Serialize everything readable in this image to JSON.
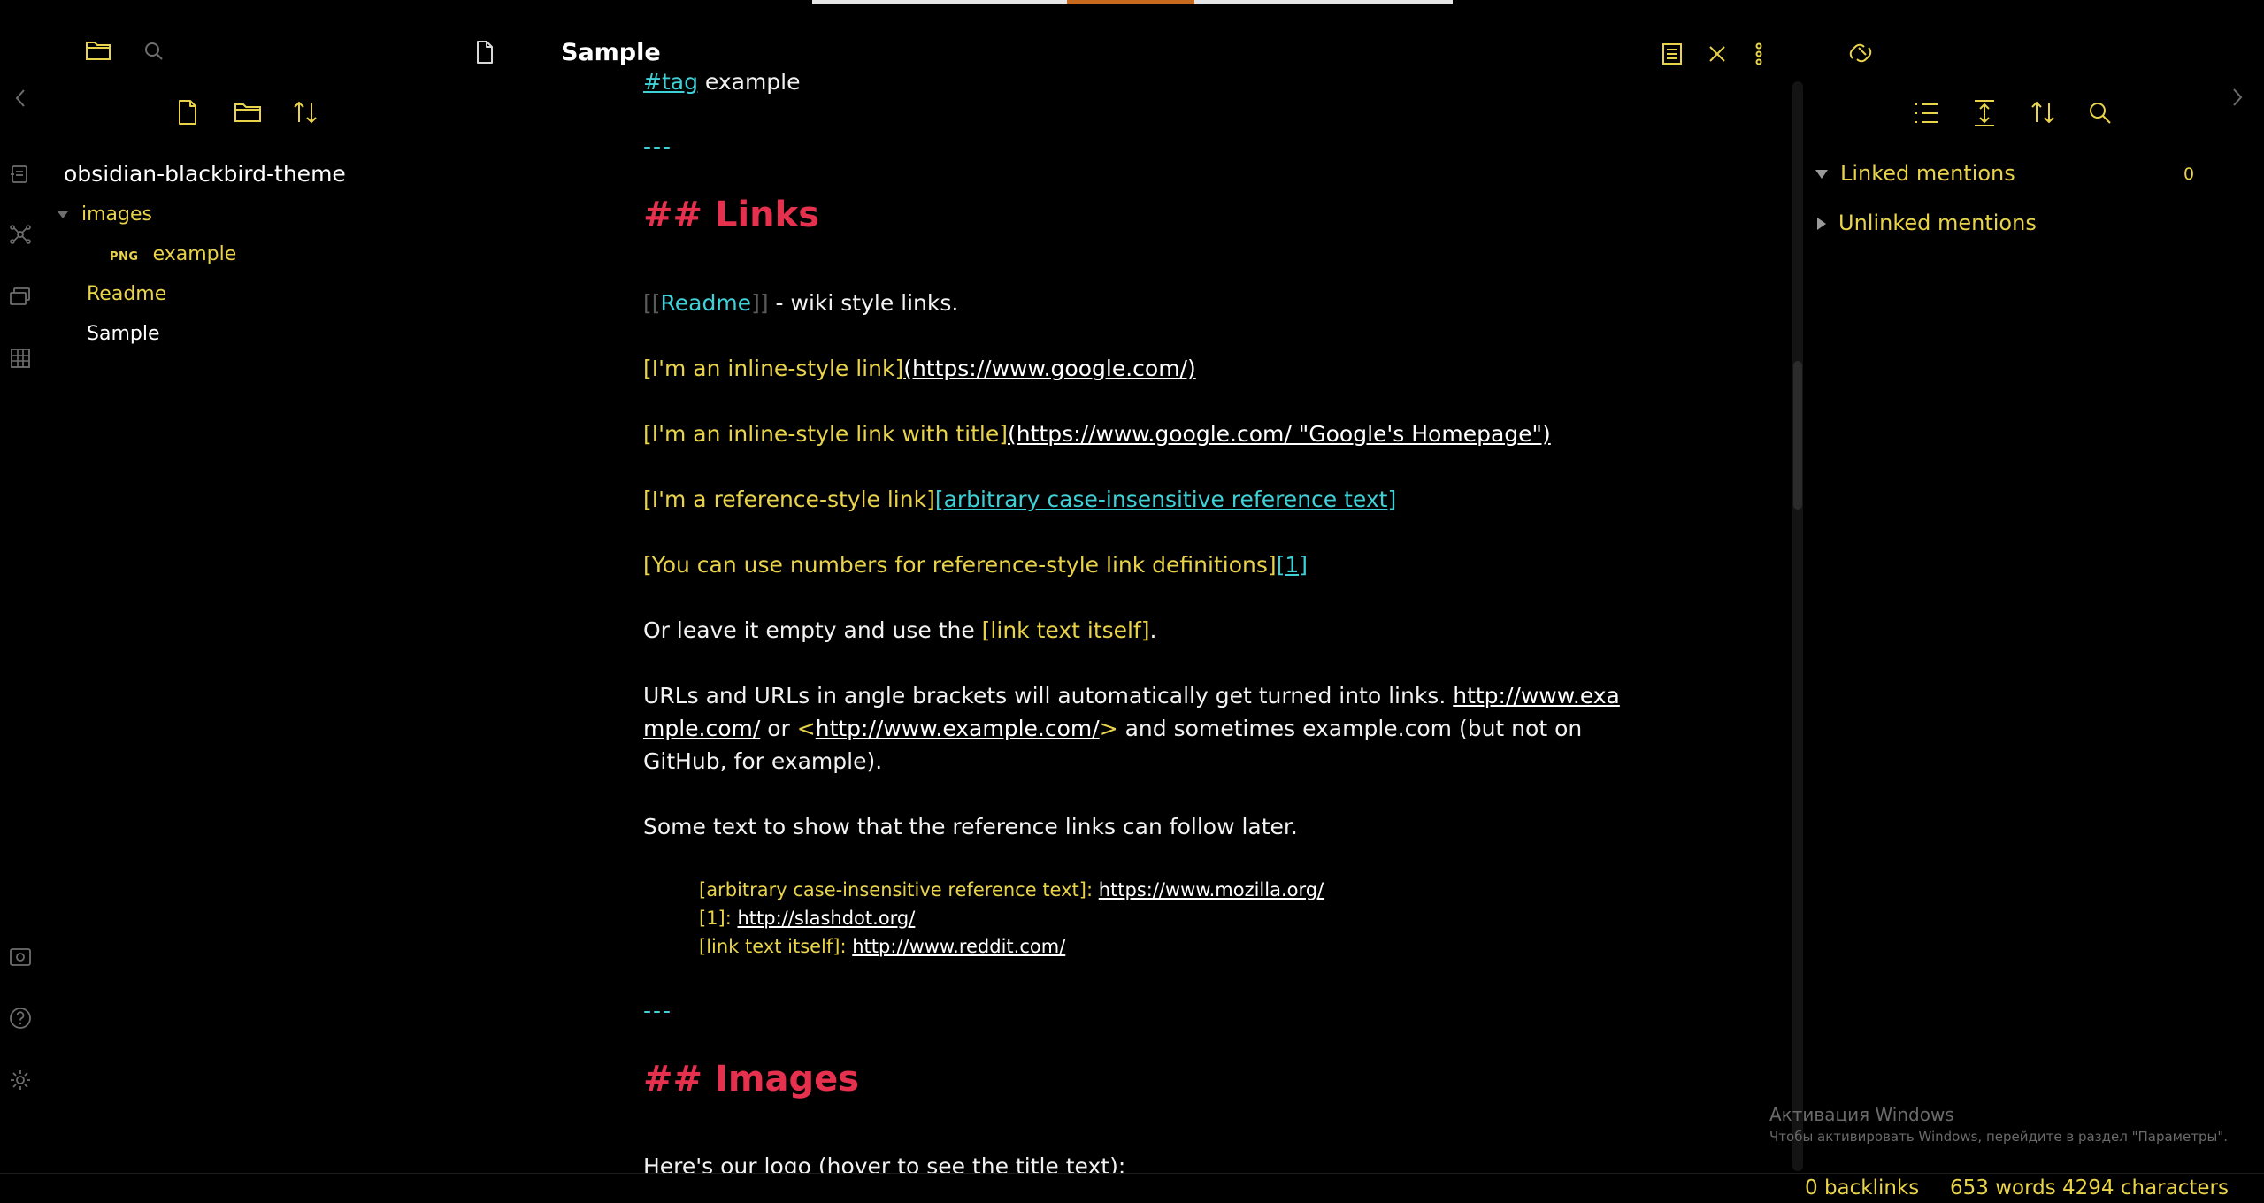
{
  "file_explorer": {
    "vault_name": "obsidian-blackbird-theme",
    "tree": {
      "folder": "images",
      "file_badge": "PNG",
      "file_name": "example",
      "notes": [
        "Readme",
        "Sample"
      ]
    }
  },
  "editor": {
    "tab_title": "Sample",
    "lines": {
      "tag": "#tag",
      "tag_rest": " example",
      "hr1": "---",
      "h2_links": "## Links",
      "wiki_open": "[[",
      "wiki_name": "Readme",
      "wiki_close": "]]",
      "wiki_rest": " - wiki style links.",
      "inline1_text": "[I'm an inline-style link]",
      "inline1_url": "(https://www.google.com/)",
      "inline2_text": "[I'm an inline-style link with title]",
      "inline2_url": "(https://www.google.com/ \"Google's Homepage\")",
      "refstyle_text": "[I'm a reference-style link]",
      "refstyle_ref": "[arbitrary case-insensitive reference text]",
      "numbers_text": "[You can use numbers for reference-style link definitions]",
      "numbers_ref": "[1]",
      "empty_pre": "Or leave it empty and use the ",
      "empty_link": "[link text itself]",
      "empty_post": ".",
      "urls_pre": "URLs and URLs in angle brackets will automatically get turned into links. ",
      "urls_link1a": "http://www.exa",
      "urls_link1b": "mple.com/",
      "urls_or": " or ",
      "urls_lt": "<",
      "urls_link2": "http://www.example.com/",
      "urls_gt": ">",
      "urls_post": " and sometimes example.com (but not on",
      "urls_line3": "GitHub, for example).",
      "some_text": "Some text to show that the reference links can follow later.",
      "ref_def1_label": "[arbitrary case-insensitive reference text]: ",
      "ref_def1_url": "https://www.mozilla.org/",
      "ref_def2_label": "[1]: ",
      "ref_def2_url": "http://slashdot.org/",
      "ref_def3_label": "[link text itself]: ",
      "ref_def3_url": "http://www.reddit.com/",
      "hr2": "---",
      "h2_images": "## Images",
      "logo_line": "Here's our logo (hover to see the title text):"
    }
  },
  "backlinks": {
    "linked_label": "Linked mentions",
    "linked_count": "0",
    "unlinked_label": "Unlinked mentions"
  },
  "watermark": {
    "line1": "Активация Windows",
    "line2": "Чтобы активировать Windows, перейдите в раздел \"Параметры\"."
  },
  "status_bar": {
    "backlinks": "0 backlinks",
    "words": "653 words",
    "characters": "4294 characters"
  },
  "colors": {
    "accent_yellow": "#e8d34a",
    "heading_red": "#e5304e",
    "link_cyan": "#3fd1d8",
    "background": "#000000"
  }
}
